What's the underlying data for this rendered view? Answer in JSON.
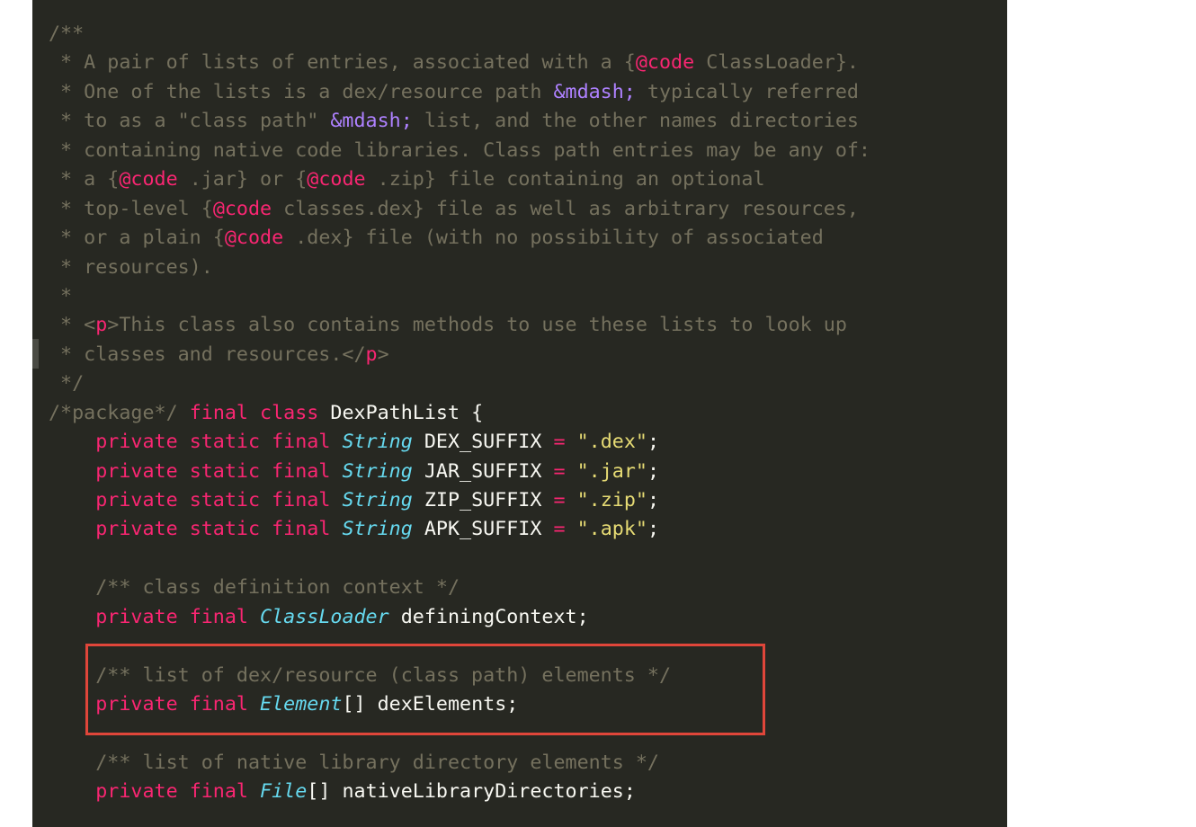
{
  "editor": {
    "lines": [
      [
        {
          "c": "c",
          "t": "/**"
        }
      ],
      [
        {
          "c": "c",
          "t": " * A pair of lists of entries, associated with a {"
        },
        {
          "c": "m",
          "t": "@code"
        },
        {
          "c": "c",
          "t": " ClassLoader}."
        }
      ],
      [
        {
          "c": "c",
          "t": " * One of the lists is a dex/resource path "
        },
        {
          "c": "p",
          "t": "&mdash;"
        },
        {
          "c": "c",
          "t": " typically referred"
        }
      ],
      [
        {
          "c": "c",
          "t": " * to as a \"class path\" "
        },
        {
          "c": "p",
          "t": "&mdash;"
        },
        {
          "c": "c",
          "t": " list, and the other names directories"
        }
      ],
      [
        {
          "c": "c",
          "t": " * containing native code libraries. Class path entries may be any of:"
        }
      ],
      [
        {
          "c": "c",
          "t": " * a {"
        },
        {
          "c": "m",
          "t": "@code"
        },
        {
          "c": "c",
          "t": " .jar} or {"
        },
        {
          "c": "m",
          "t": "@code"
        },
        {
          "c": "c",
          "t": " .zip} file containing an optional"
        }
      ],
      [
        {
          "c": "c",
          "t": " * top-level {"
        },
        {
          "c": "m",
          "t": "@code"
        },
        {
          "c": "c",
          "t": " classes.dex} file as well as arbitrary resources,"
        }
      ],
      [
        {
          "c": "c",
          "t": " * or a plain {"
        },
        {
          "c": "m",
          "t": "@code"
        },
        {
          "c": "c",
          "t": " .dex} file (with no possibility of associated"
        }
      ],
      [
        {
          "c": "c",
          "t": " * resources)."
        }
      ],
      [
        {
          "c": "c",
          "t": " *"
        }
      ],
      [
        {
          "c": "c",
          "t": " * <"
        },
        {
          "c": "m",
          "t": "p"
        },
        {
          "c": "c",
          "t": ">This class also contains methods to use these lists to look up"
        }
      ],
      [
        {
          "c": "c",
          "t": " * classes and resources.</"
        },
        {
          "c": "m",
          "t": "p"
        },
        {
          "c": "c",
          "t": ">"
        }
      ],
      [
        {
          "c": "c",
          "t": " */"
        }
      ],
      [
        {
          "c": "c",
          "t": "/*package*/"
        },
        {
          "c": "w",
          "t": " "
        },
        {
          "c": "m",
          "t": "final class"
        },
        {
          "c": "w",
          "t": " DexPathList {"
        }
      ],
      [
        {
          "c": "w",
          "t": "    "
        },
        {
          "c": "m",
          "t": "private static final"
        },
        {
          "c": "w",
          "t": " "
        },
        {
          "c": "t",
          "t": "String"
        },
        {
          "c": "w",
          "t": " DEX_SUFFIX "
        },
        {
          "c": "m",
          "t": "="
        },
        {
          "c": "w",
          "t": " "
        },
        {
          "c": "s",
          "t": "\".dex\""
        },
        {
          "c": "w",
          "t": ";"
        }
      ],
      [
        {
          "c": "w",
          "t": "    "
        },
        {
          "c": "m",
          "t": "private static final"
        },
        {
          "c": "w",
          "t": " "
        },
        {
          "c": "t",
          "t": "String"
        },
        {
          "c": "w",
          "t": " JAR_SUFFIX "
        },
        {
          "c": "m",
          "t": "="
        },
        {
          "c": "w",
          "t": " "
        },
        {
          "c": "s",
          "t": "\".jar\""
        },
        {
          "c": "w",
          "t": ";"
        }
      ],
      [
        {
          "c": "w",
          "t": "    "
        },
        {
          "c": "m",
          "t": "private static final"
        },
        {
          "c": "w",
          "t": " "
        },
        {
          "c": "t",
          "t": "String"
        },
        {
          "c": "w",
          "t": " ZIP_SUFFIX "
        },
        {
          "c": "m",
          "t": "="
        },
        {
          "c": "w",
          "t": " "
        },
        {
          "c": "s",
          "t": "\".zip\""
        },
        {
          "c": "w",
          "t": ";"
        }
      ],
      [
        {
          "c": "w",
          "t": "    "
        },
        {
          "c": "m",
          "t": "private static final"
        },
        {
          "c": "w",
          "t": " "
        },
        {
          "c": "t",
          "t": "String"
        },
        {
          "c": "w",
          "t": " APK_SUFFIX "
        },
        {
          "c": "m",
          "t": "="
        },
        {
          "c": "w",
          "t": " "
        },
        {
          "c": "s",
          "t": "\".apk\""
        },
        {
          "c": "w",
          "t": ";"
        }
      ],
      [],
      [
        {
          "c": "w",
          "t": "    "
        },
        {
          "c": "c",
          "t": "/** class definition context */"
        }
      ],
      [
        {
          "c": "w",
          "t": "    "
        },
        {
          "c": "m",
          "t": "private final"
        },
        {
          "c": "w",
          "t": " "
        },
        {
          "c": "t",
          "t": "ClassLoader"
        },
        {
          "c": "w",
          "t": " definingContext;"
        }
      ],
      [],
      [
        {
          "c": "w",
          "t": "    "
        },
        {
          "c": "c",
          "t": "/** list of dex/resource (class path) elements */"
        }
      ],
      [
        {
          "c": "w",
          "t": "    "
        },
        {
          "c": "m",
          "t": "private final"
        },
        {
          "c": "w",
          "t": " "
        },
        {
          "c": "t",
          "t": "Element"
        },
        {
          "c": "w",
          "t": "[] dexElements;"
        }
      ],
      [],
      [
        {
          "c": "w",
          "t": "    "
        },
        {
          "c": "c",
          "t": "/** list of native library directory elements */"
        }
      ],
      [
        {
          "c": "w",
          "t": "    "
        },
        {
          "c": "m",
          "t": "private final"
        },
        {
          "c": "w",
          "t": " "
        },
        {
          "c": "t",
          "t": "File"
        },
        {
          "c": "w",
          "t": "[] nativeLibraryDirectories;"
        }
      ]
    ]
  },
  "colors": {
    "background": "#272822",
    "comment": "#75715e",
    "keyword": "#f92672",
    "entity": "#ae81ff",
    "type": "#66d9ef",
    "string": "#e6db74",
    "text": "#f8f8f2",
    "highlight_border": "#e0463a"
  }
}
